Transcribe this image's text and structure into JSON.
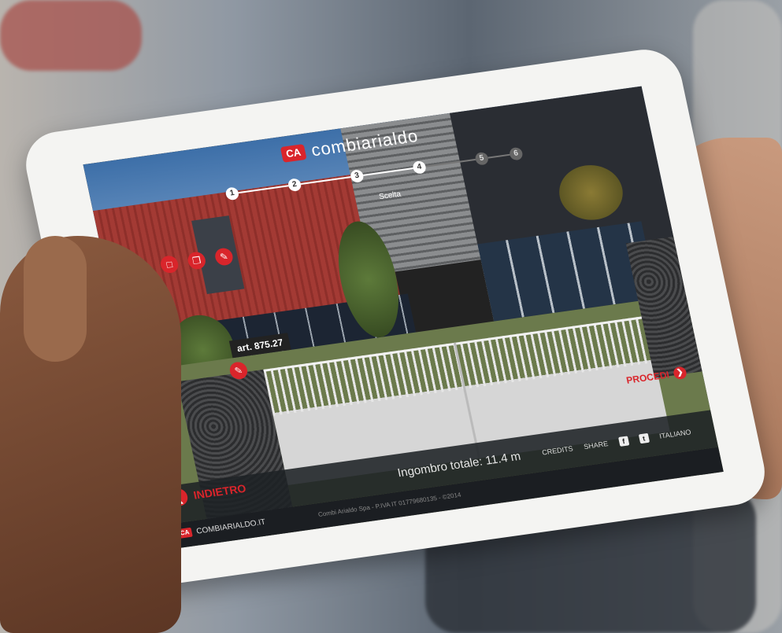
{
  "brand": {
    "name": "combiarialdo",
    "mark": "CA"
  },
  "steps": [
    "1",
    "2",
    "3",
    "4",
    "5",
    "6"
  ],
  "step_caption": "Scelta",
  "article": {
    "label": "art. 875.27"
  },
  "total": "Ingombro totale: 11.4 m",
  "next_button": "PROCEDI",
  "back_button": "INDIETRO",
  "links": {
    "credits": "CREDITS",
    "share": "SHARE",
    "language": "ITALIANO"
  },
  "footer": {
    "site": "COMBIARIALDO.IT",
    "company": "Combi Arialdo Spa - P.IVA IT 01779680135 - ©2014"
  },
  "colors": {
    "accent": "#d9252b",
    "bar": "#1e2226"
  },
  "icons": [
    "chat-bubble-icon",
    "copy-icon",
    "pencil-icon",
    "facebook-icon",
    "twitter-icon",
    "chevron-left-icon",
    "chevron-right-icon"
  ]
}
